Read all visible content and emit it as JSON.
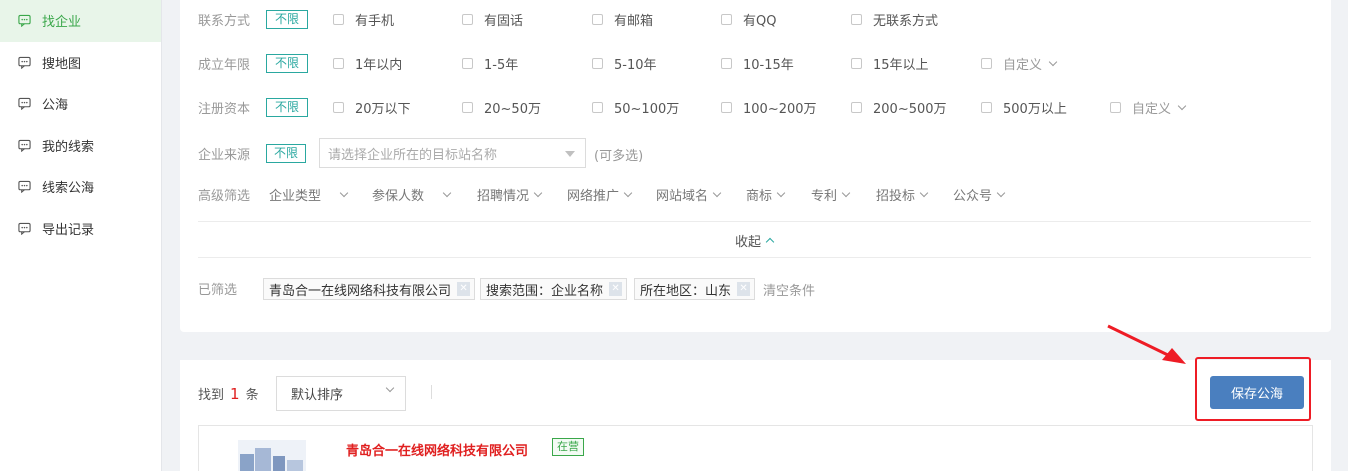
{
  "sidebar": {
    "items": [
      {
        "label": "找企业",
        "active": true
      },
      {
        "label": "搜地图"
      },
      {
        "label": "公海"
      },
      {
        "label": "我的线索"
      },
      {
        "label": "线索公海"
      },
      {
        "label": "导出记录"
      }
    ],
    "icon": "chat-bubble-icon"
  },
  "filters": {
    "no_limit": "不限",
    "contact": {
      "label": "联系方式",
      "options": [
        "有手机",
        "有固话",
        "有邮箱",
        "有QQ",
        "无联系方式"
      ]
    },
    "years": {
      "label": "成立年限",
      "options": [
        "1年以内",
        "1-5年",
        "5-10年",
        "10-15年",
        "15年以上",
        "自定义"
      ]
    },
    "capital": {
      "label": "注册资本",
      "options": [
        "20万以下",
        "20~50万",
        "50~100万",
        "100~200万",
        "200~500万",
        "500万以上",
        "自定义"
      ]
    },
    "source": {
      "label": "企业来源",
      "placeholder": "请选择企业所在的目标站名称",
      "hint": "(可多选)"
    },
    "advanced": {
      "label": "高级筛选",
      "items": [
        "企业类型",
        "参保人数",
        "招聘情况",
        "网络推广",
        "网站域名",
        "商标",
        "专利",
        "招投标",
        "公众号"
      ]
    },
    "collapse_label": "收起",
    "selected": {
      "label": "已筛选",
      "chips": [
        "青岛合一在线网络科技有限公司",
        "搜索范围：企业名称",
        "所在地区：山东"
      ],
      "clear": "清空条件"
    }
  },
  "results": {
    "found_prefix": "找到",
    "count": "1",
    "found_suffix": "条",
    "sort": "默认排序",
    "save_button": "保存公海",
    "company": {
      "name": "青岛合一在线网络科技有限公司",
      "status": "在营"
    }
  },
  "colors": {
    "accent": "#2aa8a0",
    "active_green": "#3aa74a",
    "button_blue": "#4a7fbf",
    "annotation_red": "#ee1c25"
  }
}
